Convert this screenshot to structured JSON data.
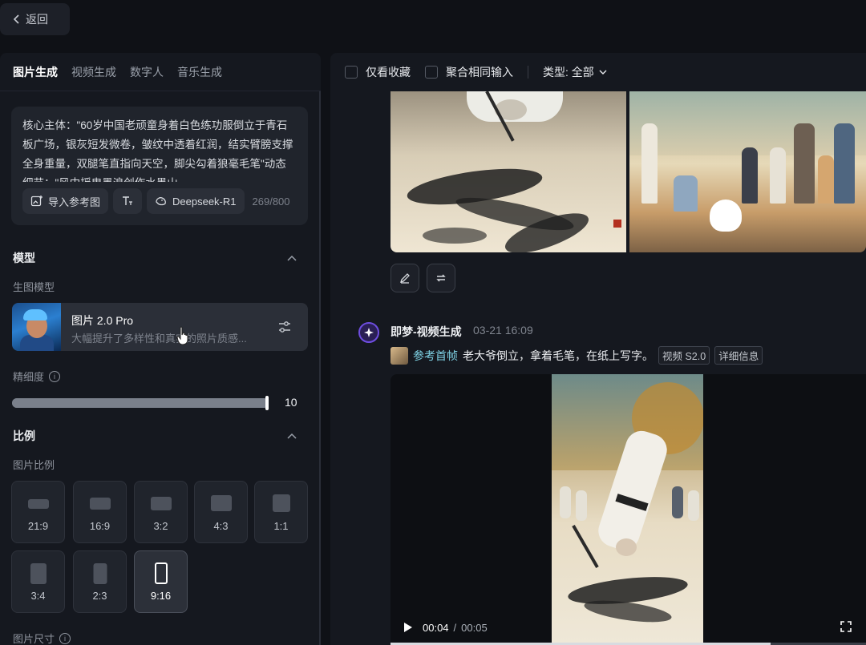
{
  "nav": {
    "back_label": "返回"
  },
  "tabs": [
    "图片生成",
    "视频生成",
    "数字人",
    "音乐生成"
  ],
  "prompt": {
    "text": "核心主体：\"60岁中国老顽童身着白色练功服倒立于青石板广场，银灰短发微卷，皱纹中透着红润，结实臂膀支撑全身重量，双腿笔直指向天空，脚尖勾着狼毫毛笔\"动态细节：\"风中摇曳墨浪创作水墨山",
    "import_label": "导入参考图",
    "model_label": "Deepseek-R1",
    "counter": "269/800"
  },
  "model_section": {
    "title": "模型",
    "sub_label": "生图模型",
    "model_name": "图片 2.0 Pro",
    "model_desc": "大幅提升了多样性和真实的照片质感..."
  },
  "detail": {
    "label": "精细度",
    "value": "10",
    "fraction": 1.0
  },
  "ratio_section": {
    "title": "比例",
    "sub_label": "图片比例",
    "options": [
      "21:9",
      "16:9",
      "3:2",
      "4:3",
      "1:1",
      "3:4",
      "2:3",
      "9:16"
    ],
    "selected": "9:16"
  },
  "size_label": "图片尺寸",
  "filters": {
    "fav_label": "仅看收藏",
    "merge_label": "聚合相同输入",
    "type_label": "类型: 全部"
  },
  "post": {
    "author": "即梦-视频生成",
    "time": "03-21  16:09",
    "ref_label": "参考首帧",
    "prompt": "老大爷倒立，拿着毛笔，在纸上写字。",
    "tag_model": "视频 S2.0",
    "tag_detail": "详细信息"
  },
  "video": {
    "current": "00:04",
    "sep": "/",
    "total": "00:05",
    "progress": 0.8
  },
  "colors": {
    "panel": "#15181f",
    "page": "#0f1116",
    "accent_link": "#7fd3e6",
    "avatar_ring": "#6e4de0"
  }
}
